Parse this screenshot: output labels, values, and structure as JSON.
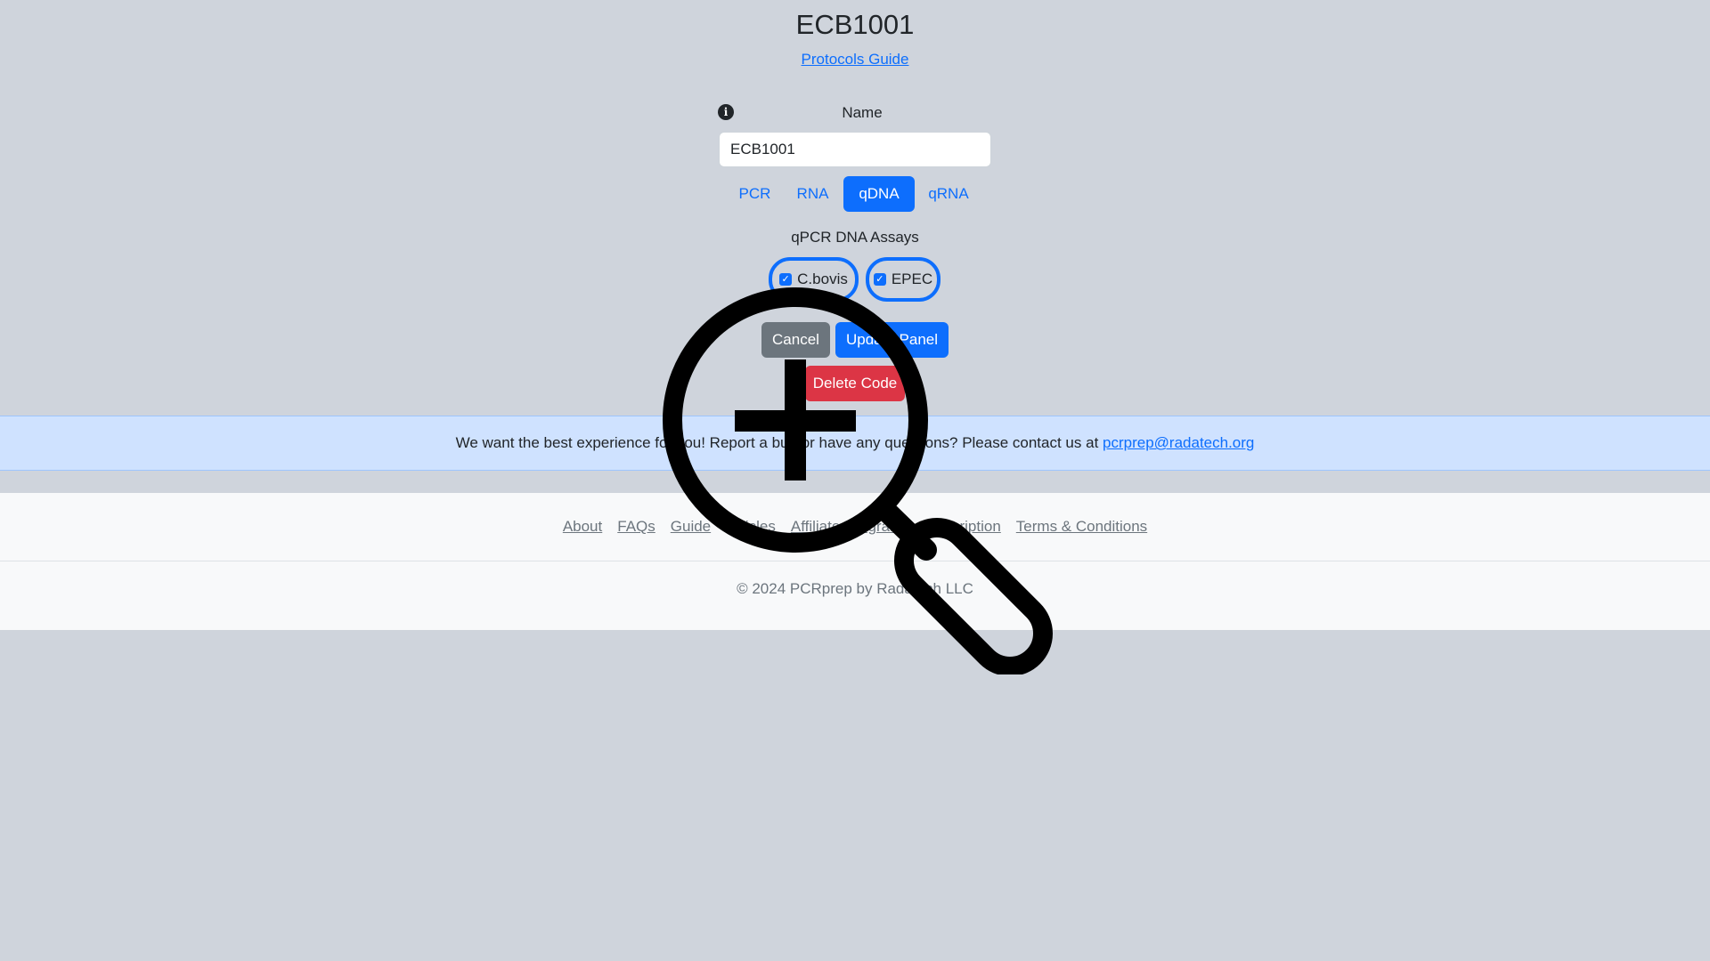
{
  "header": {
    "title": "ECB1001",
    "guide_link": "Protocols Guide"
  },
  "form": {
    "info_icon": "info-icon",
    "name_label": "Name",
    "name_value": "ECB1001",
    "tabs": [
      {
        "label": "PCR",
        "active": false
      },
      {
        "label": "RNA",
        "active": false
      },
      {
        "label": "qDNA",
        "active": true
      },
      {
        "label": "qRNA",
        "active": false
      }
    ],
    "assays_title": "qPCR DNA Assays",
    "assays": [
      {
        "label": "C.bovis",
        "checked": true
      },
      {
        "label": "EPEC",
        "checked": true
      }
    ],
    "cancel_label": "Cancel",
    "update_label": "Update Panel",
    "delete_label": "Delete Code"
  },
  "alert": {
    "text": "We want the best experience for you! Report a bug or have any questions? Please contact us at ",
    "email": "pcrprep@radatech.org"
  },
  "footer": {
    "links": [
      "About",
      "FAQs",
      "Guide",
      "Articles",
      "Affiliate Program",
      "Subscription",
      "Terms & Conditions"
    ],
    "copyright": "© 2024 PCRprep by Radatech LLC"
  },
  "overlay": {
    "icon": "zoom-in-icon"
  },
  "colors": {
    "background": "#cfd4dc",
    "primary": "#0d6efd",
    "secondary": "#6c757d",
    "danger": "#dc3545",
    "alert_bg": "#cfe2ff"
  }
}
